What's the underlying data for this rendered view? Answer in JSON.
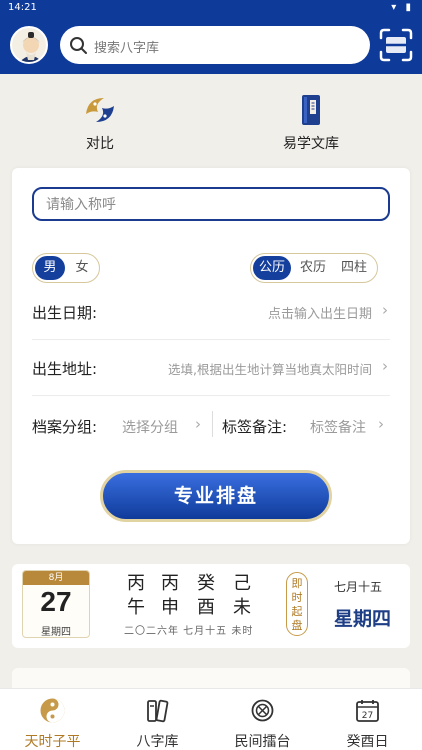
{
  "status_bar": {
    "time": "14:21",
    "left_icons": "⚙",
    "right_icons": "▾ ▮"
  },
  "header": {
    "search_placeholder": "搜索八字库",
    "icons": [
      "avatar-icon",
      "search-icon",
      "scan-icon"
    ]
  },
  "shortcuts": [
    {
      "label": "对比",
      "icon": "fish-compare-icon"
    },
    {
      "label": "易学文库",
      "icon": "book-icon"
    }
  ],
  "form": {
    "nickname_placeholder": "请输入称呼",
    "gender": {
      "options": [
        "男",
        "女"
      ],
      "selected": "男"
    },
    "calendar": {
      "options": [
        "公历",
        "农历",
        "四柱"
      ],
      "selected": "公历"
    },
    "birth_date": {
      "label": "出生日期:",
      "placeholder": "点击输入出生日期"
    },
    "birth_place": {
      "label": "出生地址:",
      "placeholder": "选填,根据出生地计算当地真太阳时间"
    },
    "group": {
      "label": "档案分组:",
      "placeholder": "选择分组"
    },
    "tag_note": {
      "label": "标签备注:",
      "placeholder": "标签备注"
    },
    "chevron": "›",
    "submit_label": "专业排盘"
  },
  "calendar_card": {
    "month": "8月",
    "day": "27",
    "weekday_small": "星期四",
    "ganzhi": [
      {
        "stem": "丙",
        "branch": "午"
      },
      {
        "stem": "丙",
        "branch": "申"
      },
      {
        "stem": "癸",
        "branch": "酉"
      },
      {
        "stem": "己",
        "branch": "未"
      }
    ],
    "lunar_full": "二〇二六年 七月十五 未时",
    "instant_button": "即时起盘",
    "lunar_short": "七月十五",
    "weekday_large": "星期四"
  },
  "nav": [
    {
      "label": "天时子平",
      "icon": "yinyang-icon",
      "active": true
    },
    {
      "label": "八字库",
      "icon": "books-icon",
      "active": false
    },
    {
      "label": "民间擂台",
      "icon": "arena-icon",
      "active": false
    },
    {
      "label": "癸酉日",
      "icon": "calendar-icon",
      "active": false
    }
  ],
  "nav_calendar_day": "27",
  "colors": {
    "brand": "#0e3a9a",
    "gold": "#b07a25",
    "active_nav": "#b07a25"
  }
}
